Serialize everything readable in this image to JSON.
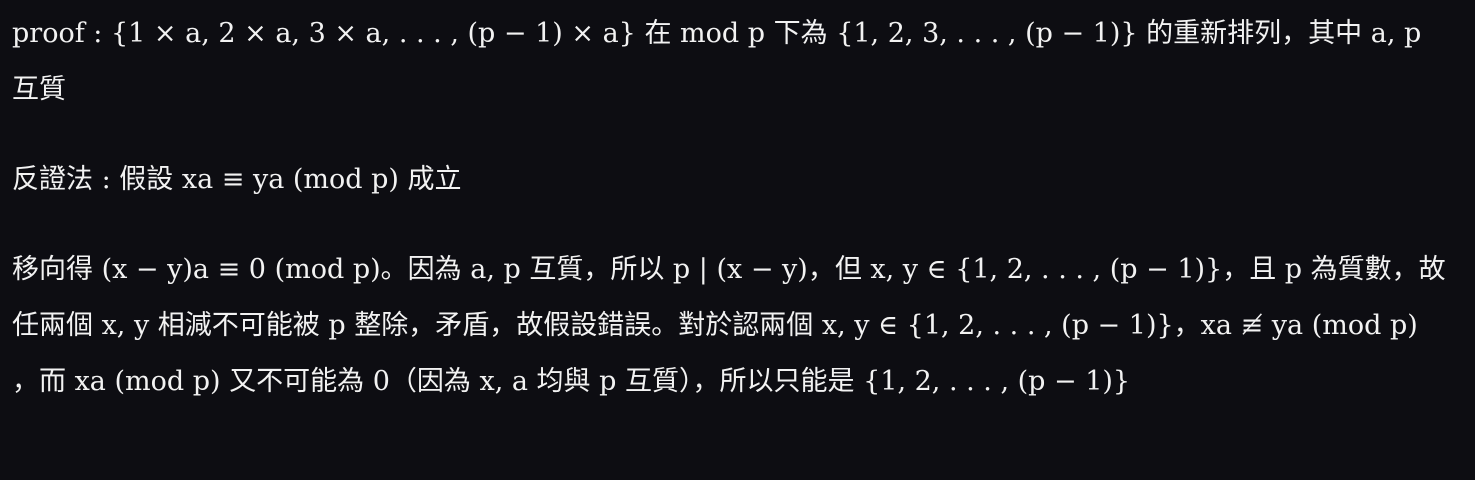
{
  "document": {
    "paragraphs": [
      {
        "text": "proof : {1 × a, 2 × a, 3 × a, . . . , (p − 1) × a} 在 mod p 下為 {1, 2, 3, . . . , (p − 1)} 的重新排列，其中 a, p 互質"
      },
      {
        "text": "反證法 : 假設 xa ≡ ya  (mod  p) 成立"
      },
      {
        "text": "移向得 (x − y)a ≡ 0  (mod  p)。因為 a, p 互質，所以 p | (x − y)，但 x, y ∈ {1, 2, . . . , (p − 1)}，且 p 為質數，故任兩個 x, y 相減不可能被 p 整除，矛盾，故假設錯誤。對於認兩個 x, y ∈ {1, 2, . . . , (p − 1)}，xa ≢ ya  (mod  p) ，而  xa  (mod  p) 又不可能為 0（因為 x, a 均與 p 互質），所以只能是 {1, 2, . . . , (p − 1)}"
      }
    ]
  }
}
